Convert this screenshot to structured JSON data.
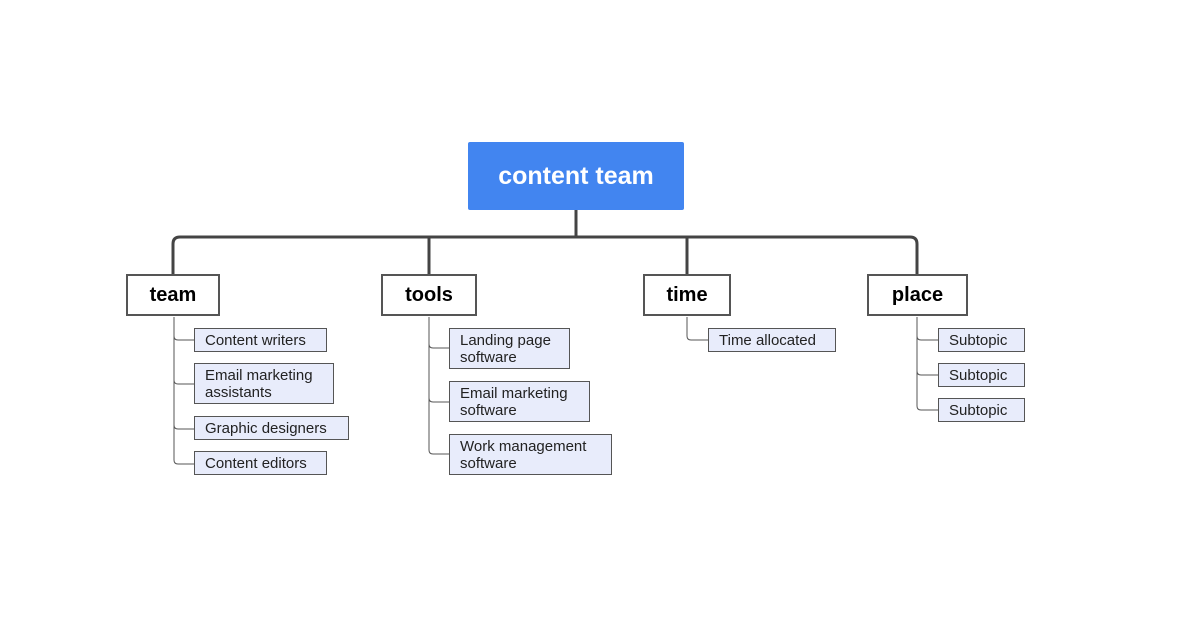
{
  "root": {
    "label": "content team",
    "color": "#4285f0"
  },
  "topics": [
    {
      "label": "team",
      "subtopics": [
        "Content writers",
        "Email marketing assistants",
        "Graphic designers",
        "Content editors"
      ]
    },
    {
      "label": "tools",
      "subtopics": [
        "Landing page software",
        "Email marketing software",
        "Work management software"
      ]
    },
    {
      "label": "time",
      "subtopics": [
        "Time allocated"
      ]
    },
    {
      "label": "place",
      "subtopics": [
        "Subtopic",
        "Subtopic",
        "Subtopic"
      ]
    }
  ]
}
